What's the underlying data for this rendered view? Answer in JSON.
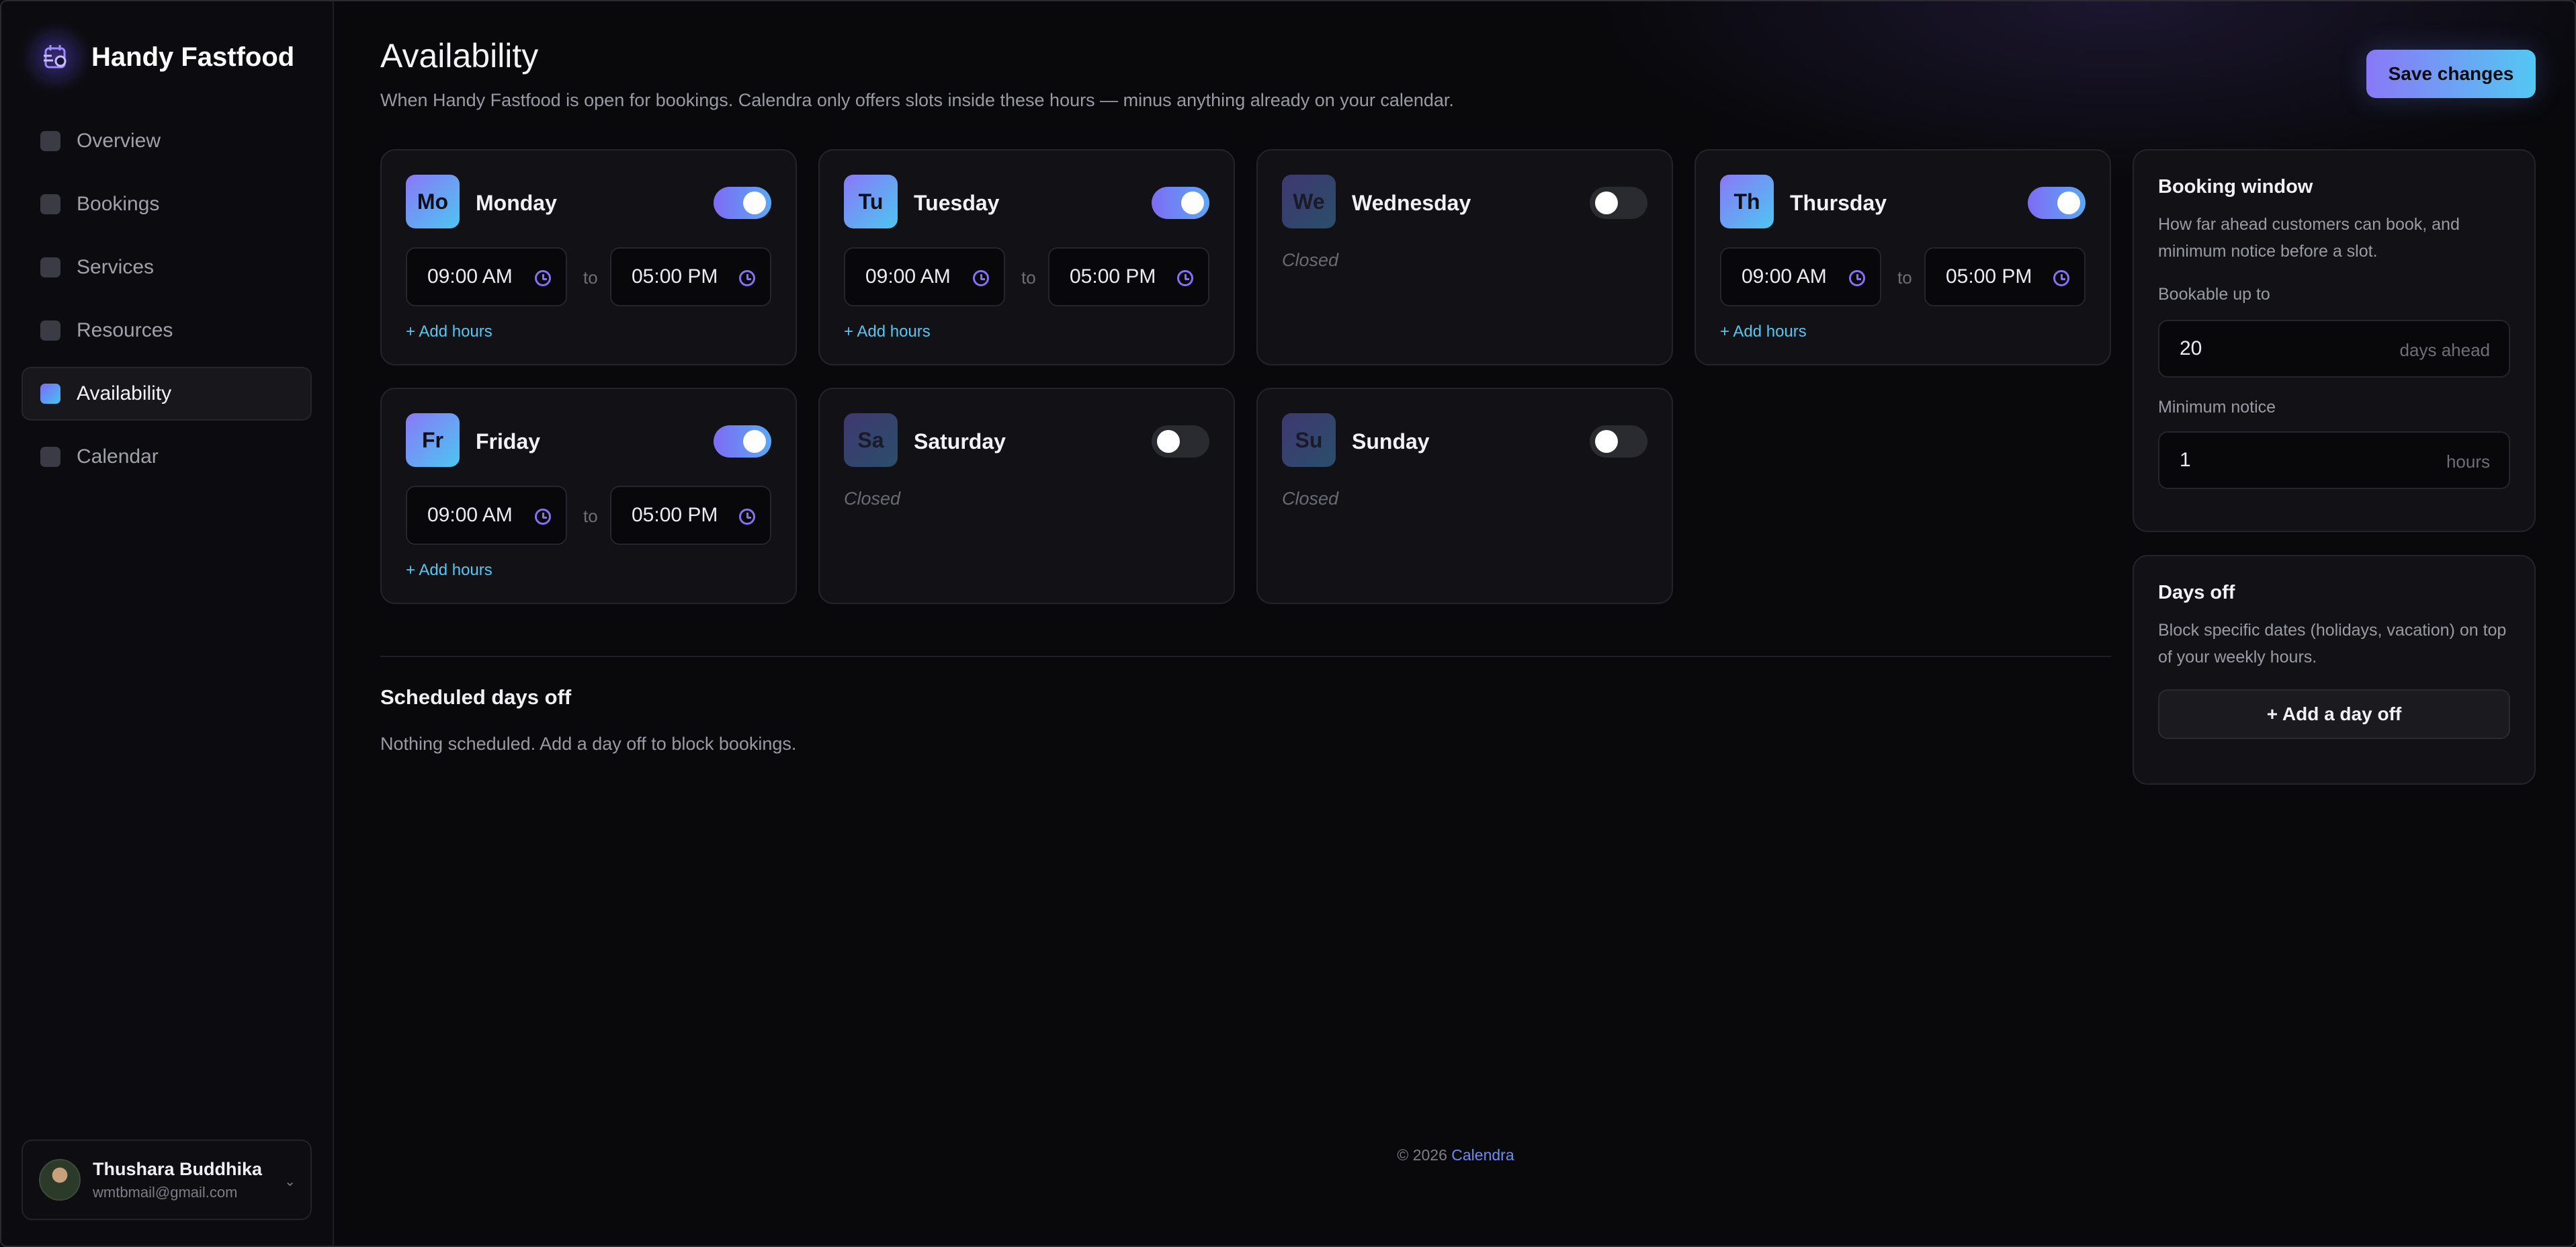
{
  "sidebar": {
    "brand": "Handy Fastfood",
    "items": [
      {
        "label": "Overview",
        "active": false
      },
      {
        "label": "Bookings",
        "active": false
      },
      {
        "label": "Services",
        "active": false
      },
      {
        "label": "Resources",
        "active": false
      },
      {
        "label": "Availability",
        "active": true
      },
      {
        "label": "Calendar",
        "active": false
      }
    ],
    "user": {
      "name": "Thushara Buddhika",
      "email": "wmtbmail@gmail.com"
    }
  },
  "header": {
    "title": "Availability",
    "subtitle": "When Handy Fastfood is open for bookings. Calendra only offers slots inside these hours — minus anything already on your calendar.",
    "save_label": "Save changes"
  },
  "days": [
    {
      "abbr": "Mo",
      "name": "Monday",
      "enabled": true,
      "from": "09:00 AM",
      "to": "05:00 PM"
    },
    {
      "abbr": "Tu",
      "name": "Tuesday",
      "enabled": true,
      "from": "09:00 AM",
      "to": "05:00 PM"
    },
    {
      "abbr": "We",
      "name": "Wednesday",
      "enabled": false
    },
    {
      "abbr": "Th",
      "name": "Thursday",
      "enabled": true,
      "from": "09:00 AM",
      "to": "05:00 PM"
    },
    {
      "abbr": "Fr",
      "name": "Friday",
      "enabled": true,
      "from": "09:00 AM",
      "to": "05:00 PM"
    },
    {
      "abbr": "Sa",
      "name": "Saturday",
      "enabled": false
    },
    {
      "abbr": "Su",
      "name": "Sunday",
      "enabled": false
    }
  ],
  "labels": {
    "to": "to",
    "add_hours": "+ Add hours",
    "closed": "Closed"
  },
  "scheduled": {
    "title": "Scheduled days off",
    "empty": "Nothing scheduled. Add a day off to block bookings."
  },
  "booking_window": {
    "title": "Booking window",
    "desc": "How far ahead customers can book, and minimum notice before a slot.",
    "bookable_label": "Bookable up to",
    "bookable_value": "20",
    "bookable_suffix": "days ahead",
    "notice_label": "Minimum notice",
    "notice_value": "1",
    "notice_suffix": "hours"
  },
  "days_off": {
    "title": "Days off",
    "desc": "Block specific dates (holidays, vacation) on top of your weekly hours.",
    "button": "+ Add a day off"
  },
  "footer": {
    "copyright": "© 2026",
    "brand": "Calendra"
  }
}
